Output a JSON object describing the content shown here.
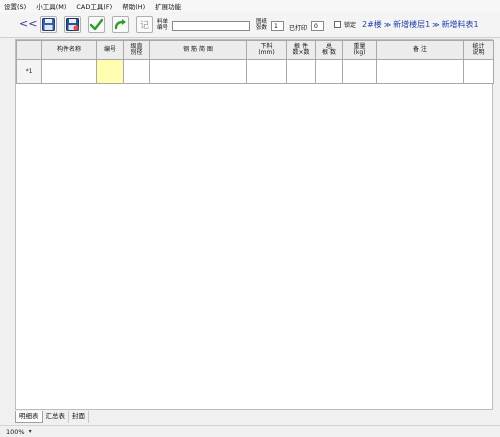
{
  "menu": [
    "设置(S)",
    "小工具(M)",
    "CAD工具(F)",
    "帮助(H)",
    "扩展功能"
  ],
  "toolbar": {
    "collapse_glyph": "<<",
    "record_label": "记",
    "material_no_label_1": "料单",
    "material_no_label_2": "编号",
    "material_no_value": "",
    "ref_count_label_1": "图纸",
    "ref_count_label_2": "张数",
    "ref_count_value": "1",
    "printed_label": "已打印",
    "printed_value": "0",
    "lock_label": "锁定",
    "lock_checked": false
  },
  "breadcrumb": {
    "items": [
      "2#楼",
      "新增楼层1",
      "新增料表1"
    ],
    "separator": "≫",
    "color": "#1f3fa8"
  },
  "table": {
    "columns": [
      {
        "l1": "",
        "l2": ""
      },
      {
        "l1": "构件名称",
        "l2": ""
      },
      {
        "l1": "编号",
        "l2": ""
      },
      {
        "l1": "级直",
        "l2": "别径"
      },
      {
        "l1": "钢 筋 简 图",
        "l2": ""
      },
      {
        "l1": "下料",
        "l2": "(mm)"
      },
      {
        "l1": "根 件",
        "l2": "数×数"
      },
      {
        "l1": "总",
        "l2": "根 数"
      },
      {
        "l1": "重量",
        "l2": "(kg)"
      },
      {
        "l1": "备     注",
        "l2": ""
      },
      {
        "l1": "统计",
        "l2": "说明"
      }
    ],
    "rows": [
      {
        "num": "*1",
        "cells": [
          "",
          "",
          "",
          "",
          "",
          "",
          "",
          "",
          "",
          ""
        ]
      }
    ],
    "highlight_color": "#fffdb0"
  },
  "sheet_tabs": [
    "明细表",
    "汇总表",
    "封面"
  ],
  "status": {
    "zoom": "100%"
  }
}
